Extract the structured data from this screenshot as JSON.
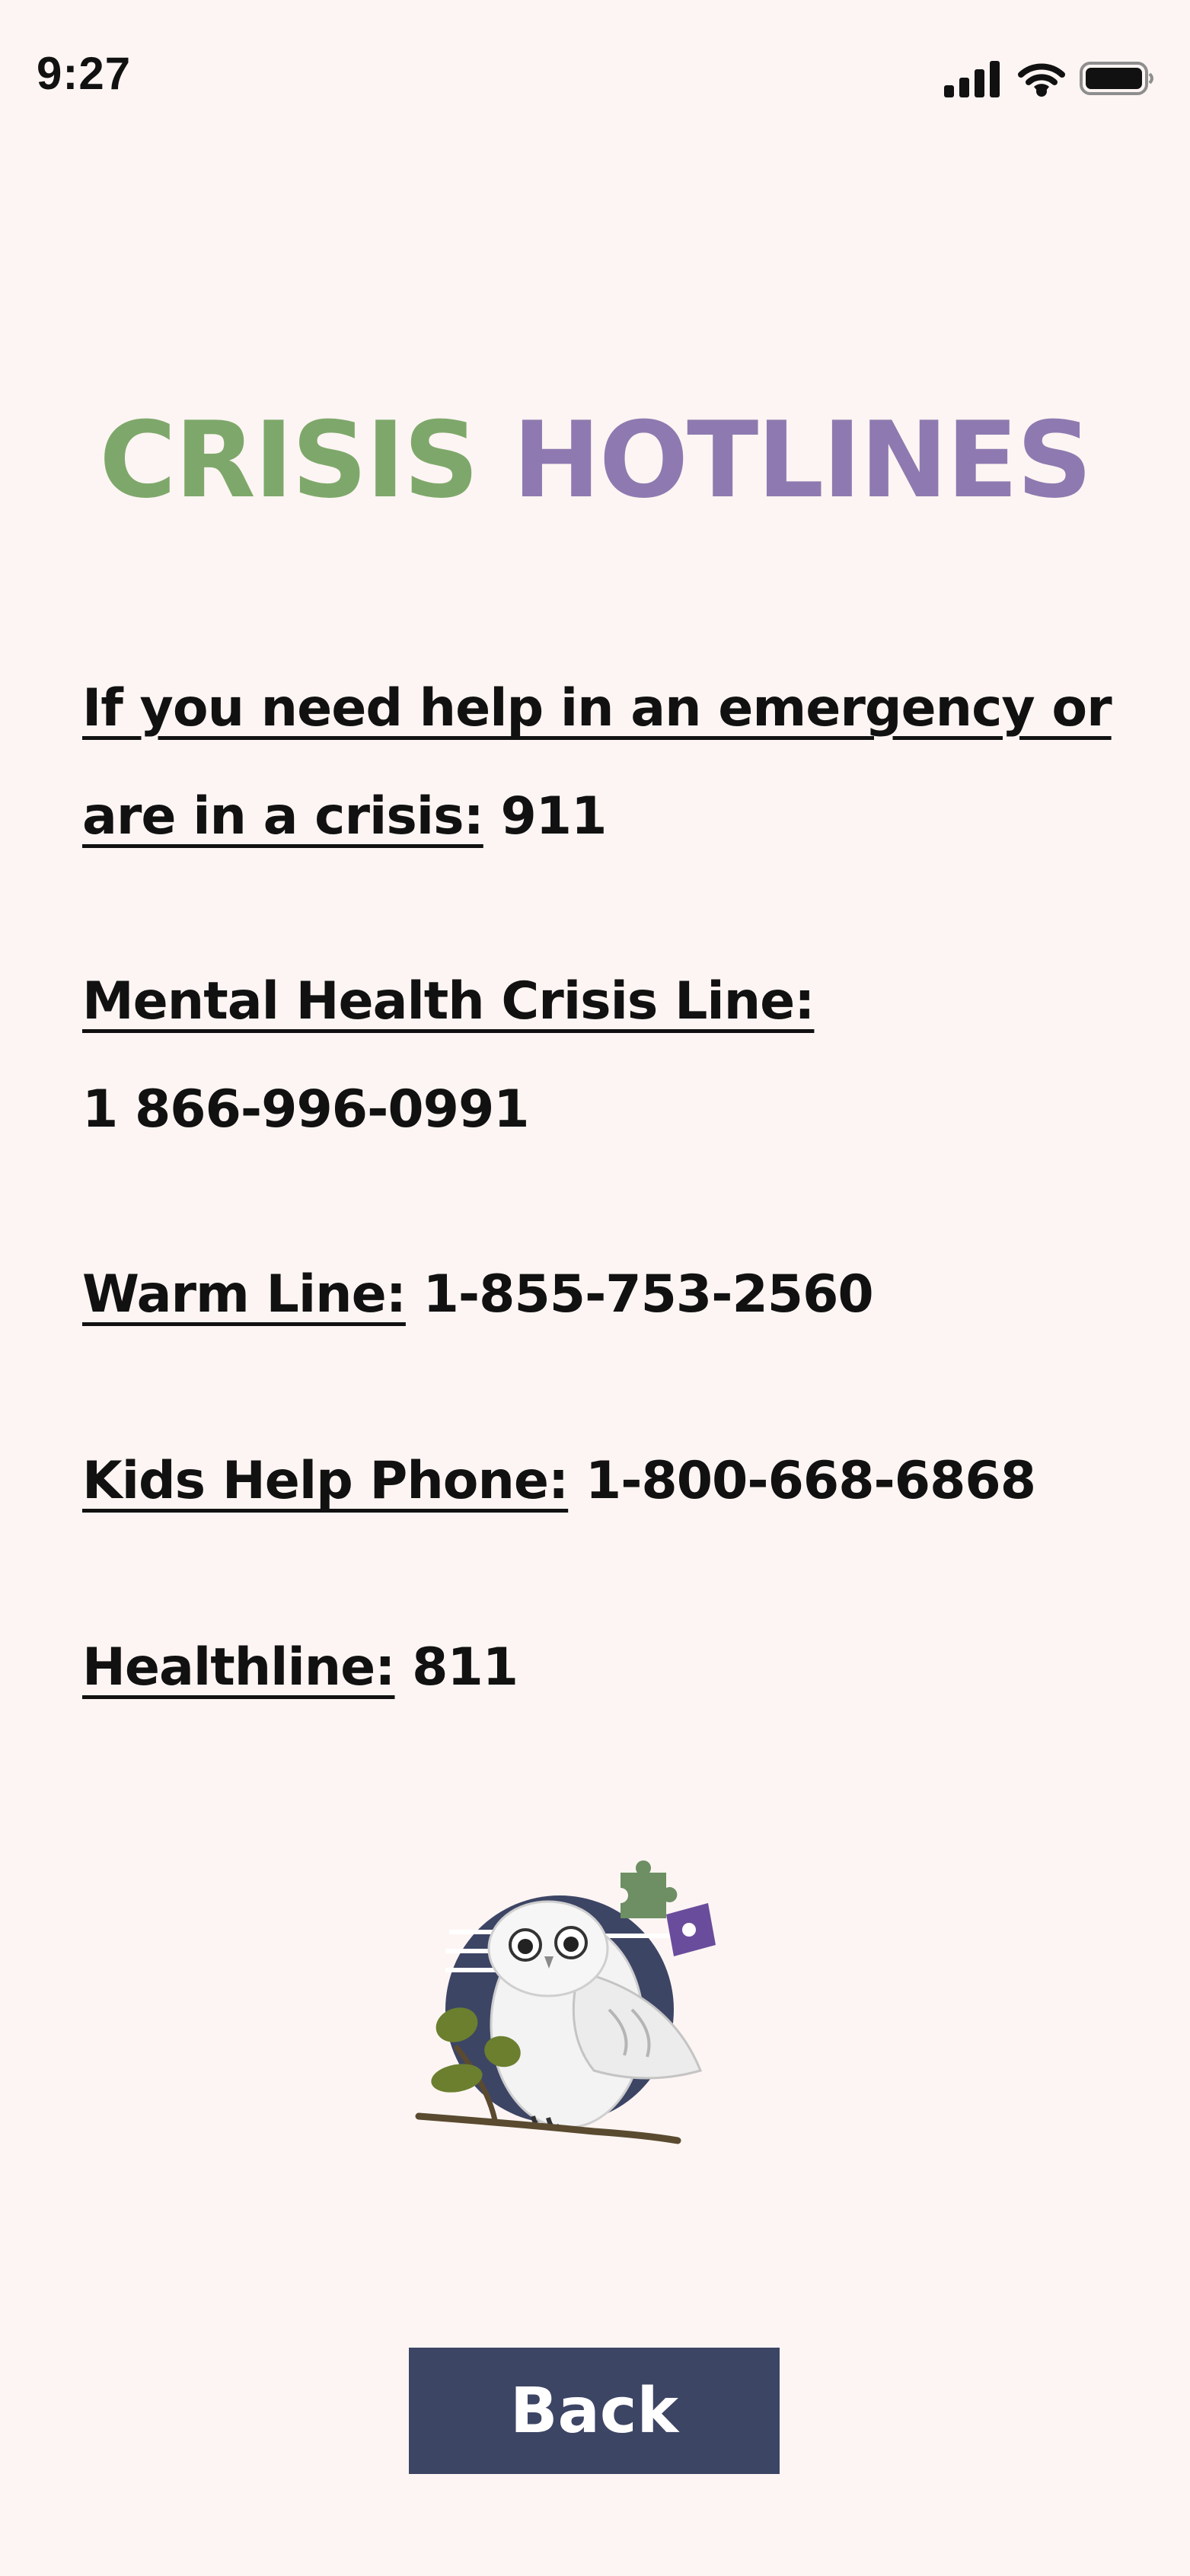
{
  "status_bar": {
    "time": "9:27",
    "icons": [
      "cellular-signal-icon",
      "wifi-icon",
      "battery-icon"
    ]
  },
  "title": {
    "part1": "CRISIS",
    "part2": "HOTLINES",
    "color_part1": "#7ea86b",
    "color_part2": "#8e7ab0"
  },
  "hotlines": [
    {
      "label": "If you need help in an emergency or are in a crisis:",
      "number": "911"
    },
    {
      "label": "Mental Health Crisis Line:",
      "number": "1 866-996-0991"
    },
    {
      "label": "Warm Line:",
      "number": "1-855-753-2560"
    },
    {
      "label": "Kids Help Phone:",
      "number": "1-800-668-6868"
    },
    {
      "label": "Healthline:",
      "number": "811"
    }
  ],
  "logo": {
    "icon": "owl-puzzle-logo",
    "colors": {
      "circle": "#3d4565",
      "leaves": "#6b7f2f",
      "puzzle_green": "#6d8f63",
      "puzzle_purple": "#6a4c9c"
    }
  },
  "back_button": {
    "label": "Back",
    "color": "#3d4565"
  },
  "theme": {
    "background": "#fdf5f3",
    "text": "#111111"
  }
}
